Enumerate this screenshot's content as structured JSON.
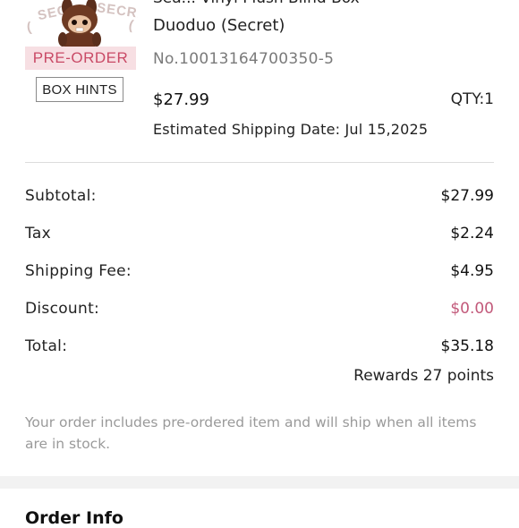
{
  "product": {
    "title_line1": "Sea... Vinyl Plush Blind Box",
    "title_line2": "Duoduo (Secret)",
    "number": "No.10013164700350-5",
    "price": "$27.99",
    "qty": "QTY:1",
    "shipping_date": "Estimated Shipping Date: Jul 15,2025",
    "preorder_badge": "PRE-ORDER",
    "box_hints_label": "BOX HINTS",
    "thumb_stamp_1": "SEC",
    "thumb_stamp_2": "SECRE",
    "thumb_stamp_3": "(",
    "thumb_stamp_4": "("
  },
  "summary": {
    "subtotal_label": "Subtotal:",
    "subtotal_value": "$27.99",
    "tax_label": "Tax",
    "tax_value": "$2.24",
    "shipping_label": "Shipping Fee:",
    "shipping_value": "$4.95",
    "discount_label": "Discount:",
    "discount_value": "$0.00",
    "total_label": "Total:",
    "total_value": "$35.18",
    "rewards": "Rewards 27 points"
  },
  "note": "Your order includes pre-ordered item and will ship when all items are in stock.",
  "order_info_heading": "Order Info",
  "colors": {
    "badge_bg": "#f7dfe3",
    "badge_text": "#c94a66",
    "discount": "#c2597a",
    "muted": "#9a9a9a"
  }
}
